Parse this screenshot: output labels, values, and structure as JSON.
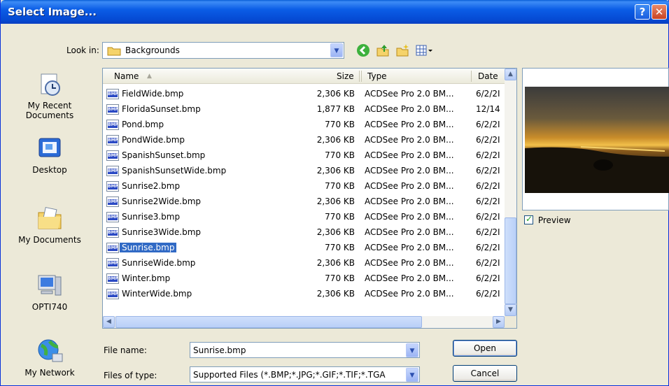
{
  "window": {
    "title": "Select Image...",
    "help_glyph": "?",
    "close_glyph": "✕"
  },
  "lookin": {
    "label": "Look in:",
    "value": "Backgrounds"
  },
  "toolbar": {
    "icons": [
      "back-icon",
      "up-folder-icon",
      "new-folder-icon",
      "views-menu-icon"
    ]
  },
  "places": [
    {
      "label_1": "My Recent",
      "label_2": "Documents",
      "icon": "recent-documents-icon"
    },
    {
      "label_1": "Desktop",
      "icon": "desktop-icon"
    },
    {
      "label_1": "My Documents",
      "icon": "my-documents-icon"
    },
    {
      "label_1": "OPTI740",
      "icon": "my-computer-icon"
    },
    {
      "label_1": "My Network",
      "icon": "my-network-icon"
    }
  ],
  "columns": {
    "name": "Name",
    "size": "Size",
    "type": "Type",
    "date": "Date"
  },
  "files": [
    {
      "name": "FieldWide.bmp",
      "size": "2,306 KB",
      "type": "ACDSee Pro 2.0 BM...",
      "date": "6/2/2І"
    },
    {
      "name": "FloridaSunset.bmp",
      "size": "1,877 KB",
      "type": "ACDSee Pro 2.0 BM...",
      "date": "12/14"
    },
    {
      "name": "Pond.bmp",
      "size": "770 KB",
      "type": "ACDSee Pro 2.0 BM...",
      "date": "6/2/2І"
    },
    {
      "name": "PondWide.bmp",
      "size": "2,306 KB",
      "type": "ACDSee Pro 2.0 BM...",
      "date": "6/2/2І"
    },
    {
      "name": "SpanishSunset.bmp",
      "size": "770 KB",
      "type": "ACDSee Pro 2.0 BM...",
      "date": "6/2/2І"
    },
    {
      "name": "SpanishSunsetWide.bmp",
      "size": "2,306 KB",
      "type": "ACDSee Pro 2.0 BM...",
      "date": "6/2/2І"
    },
    {
      "name": "Sunrise2.bmp",
      "size": "770 KB",
      "type": "ACDSee Pro 2.0 BM...",
      "date": "6/2/2І"
    },
    {
      "name": "Sunrise2Wide.bmp",
      "size": "2,306 KB",
      "type": "ACDSee Pro 2.0 BM...",
      "date": "6/2/2І"
    },
    {
      "name": "Sunrise3.bmp",
      "size": "770 KB",
      "type": "ACDSee Pro 2.0 BM...",
      "date": "6/2/2І"
    },
    {
      "name": "Sunrise3Wide.bmp",
      "size": "2,306 KB",
      "type": "ACDSee Pro 2.0 BM...",
      "date": "6/2/2І"
    },
    {
      "name": "Sunrise.bmp",
      "size": "770 KB",
      "type": "ACDSee Pro 2.0 BM...",
      "date": "6/2/2І",
      "selected": true
    },
    {
      "name": "SunriseWide.bmp",
      "size": "2,306 KB",
      "type": "ACDSee Pro 2.0 BM...",
      "date": "6/2/2І"
    },
    {
      "name": "Winter.bmp",
      "size": "770 KB",
      "type": "ACDSee Pro 2.0 BM...",
      "date": "6/2/2І"
    },
    {
      "name": "WinterWide.bmp",
      "size": "2,306 KB",
      "type": "ACDSee Pro 2.0 BM...",
      "date": "6/2/2І"
    }
  ],
  "preview": {
    "label": "Preview",
    "checked": true
  },
  "filename": {
    "label": "File name:",
    "value": "Sunrise.bmp"
  },
  "filetype": {
    "label": "Files of type:",
    "value": "Supported Files (*.BMP;*.JPG;*.GIF;*.TIF;*.TGA"
  },
  "buttons": {
    "open": "Open",
    "cancel": "Cancel"
  },
  "colors": {
    "titlebar": "#0b5de6",
    "selection": "#316ac5",
    "dialog_bg": "#ece9d8"
  }
}
